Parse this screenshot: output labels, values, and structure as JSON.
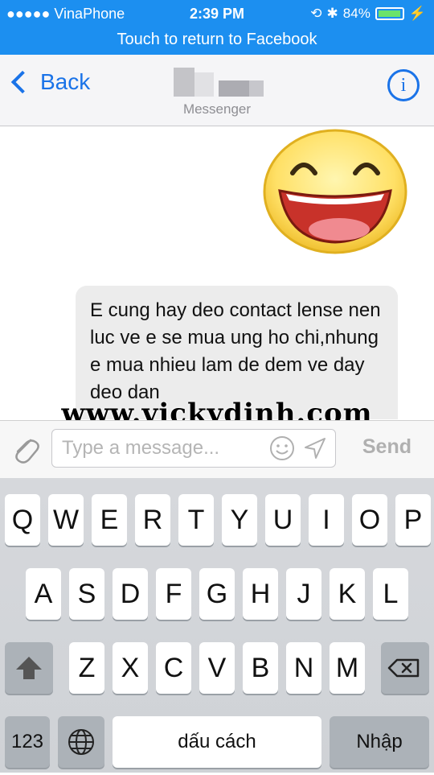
{
  "status_bar": {
    "carrier": "●●●●● VinaPhone",
    "time": "2:39 PM",
    "battery_percent": "84%",
    "battery_level": 0.84,
    "banner": "Touch to return to Facebook"
  },
  "nav": {
    "back_label": "Back",
    "subtitle": "Messenger",
    "info_glyph": "i",
    "icons": [
      "chevron-left-icon",
      "info-icon"
    ]
  },
  "chat": {
    "message_text": "E cung hay deo contact lense nen luc ve e se mua ung ho chi,nhung e mua nhieu lam de dem ve day deo dan",
    "sticker": "laughing-face-sticker"
  },
  "watermark": "www.vickydinh.com",
  "composer": {
    "placeholder": "Type a message...",
    "send_label": "Send",
    "icons": [
      "paperclip-icon",
      "smiley-icon",
      "location-arrow-icon"
    ]
  },
  "keyboard": {
    "row1": [
      "Q",
      "W",
      "E",
      "R",
      "T",
      "Y",
      "U",
      "I",
      "O",
      "P"
    ],
    "row2": [
      "A",
      "S",
      "D",
      "F",
      "G",
      "H",
      "J",
      "K",
      "L"
    ],
    "row3": [
      "Z",
      "X",
      "C",
      "V",
      "B",
      "N",
      "M"
    ],
    "numbers_label": "123",
    "space_label": "dấu cách",
    "return_label": "Nhập",
    "icons": [
      "shift-icon",
      "backspace-icon",
      "globe-icon"
    ]
  },
  "colors": {
    "status_bar": "#1c8ff0",
    "accent": "#1a73e8",
    "bubble": "#ececec",
    "keyboard": "#d2d5d9"
  }
}
